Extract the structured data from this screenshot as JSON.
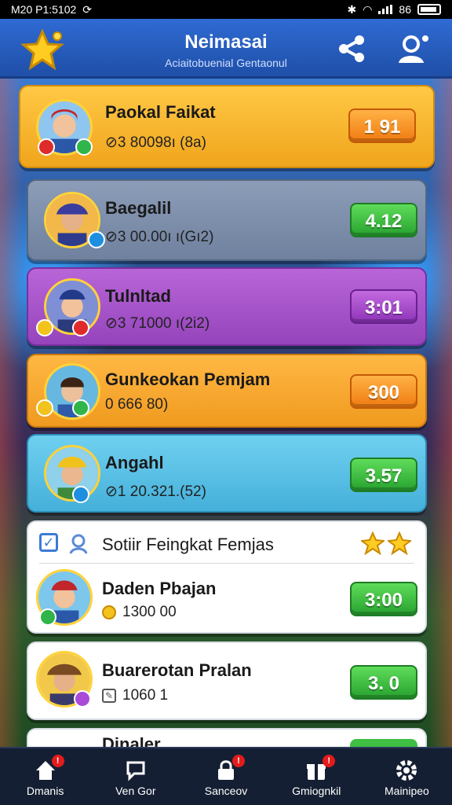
{
  "status_bar": {
    "time": "M20 P1:5102",
    "battery": "86"
  },
  "header": {
    "title": "Neimasai",
    "subtitle": "Aciaitobuenial Gentaonul",
    "logo_icon": "star-icon",
    "share_icon": "share-icon",
    "profile_icon": "profile-icon"
  },
  "leaderboard": [
    {
      "name": "Paokal Faikat",
      "stats": "⊘3 80098ı (8a)",
      "score": "1 91",
      "card_color": "#f6b52a",
      "score_style": "orange"
    },
    {
      "name": "Baegalil",
      "stats": "⊘3 00.00ı ı(Gı2)",
      "score": "4.12",
      "card_color": "#7b8da8",
      "score_style": "green"
    },
    {
      "name": "Tulnltad",
      "stats": "⊘3 71000 ı(2i2)",
      "score": "3:01",
      "card_color": "#a954c8",
      "score_style": "purple"
    },
    {
      "name": "Gunkeokan Pemjam",
      "stats": "0 666 80)",
      "score": "300",
      "card_color": "#f6a32a",
      "score_style": "orange"
    },
    {
      "name": "Angahl",
      "stats": "⊘1 20.321.(52)",
      "score": "3.57",
      "card_color": "#5ec3e6",
      "score_style": "green"
    }
  ],
  "section": {
    "title": "Sotiir Feingkat Femjas"
  },
  "your_rank": [
    {
      "name": "Daden Pbajan",
      "stats": "1300 00",
      "score": "3:00",
      "score_style": "green"
    },
    {
      "name": "Buarerotan Pralan",
      "stats": "1060 1",
      "score": "3. 0",
      "score_style": "green"
    },
    {
      "name": "Dinaler"
    }
  ],
  "bottom_nav": [
    {
      "label": "Dmanis",
      "icon": "home-icon",
      "badge": "!"
    },
    {
      "label": "Ven Gor",
      "icon": "chat-icon",
      "badge": ""
    },
    {
      "label": "Sanceov",
      "icon": "lock-icon",
      "badge": "!"
    },
    {
      "label": "Gmiognkil",
      "icon": "gift-icon",
      "badge": "!"
    },
    {
      "label": "Mainipeo",
      "icon": "gear-icon",
      "badge": ""
    }
  ],
  "colors": {
    "header_blue": "#2f6bd3",
    "accent_yellow": "#f6b52a",
    "badge_red": "#e31b1b"
  }
}
